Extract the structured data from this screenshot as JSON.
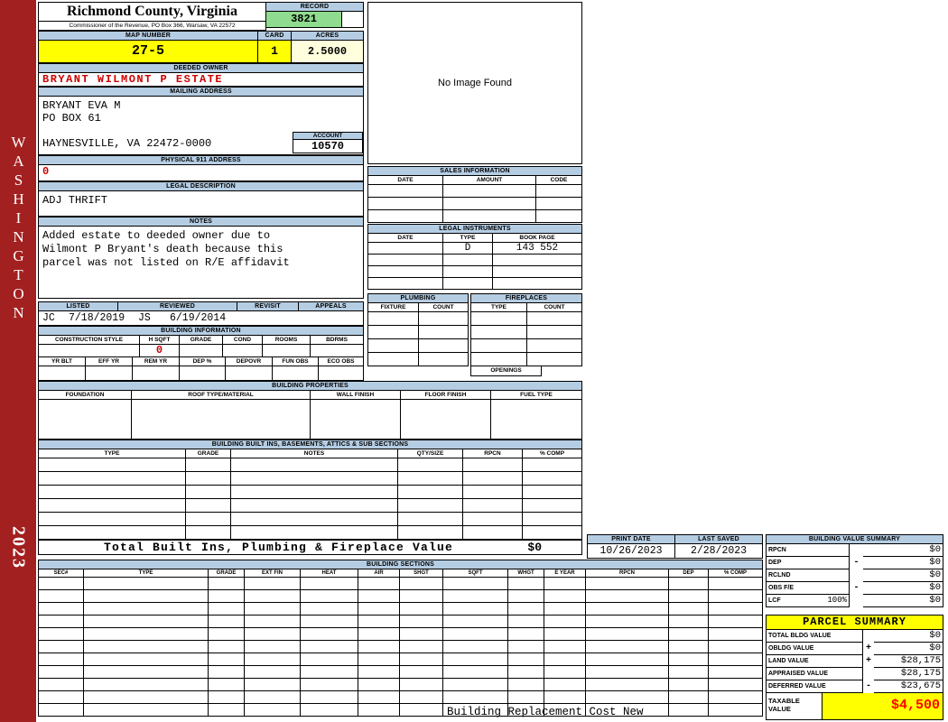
{
  "colors": {
    "header_bar": "#B5CDE3",
    "record_value_bg": "#8FDB8F",
    "highlight_yellow": "#FFFF00",
    "acres_bg": "#FFFFDE",
    "sidebar_red": "#A32020",
    "alert_red": "#CC0000",
    "taxable_red": "#FF0000"
  },
  "sidebar": {
    "state_text": "WASHINGTON",
    "year": "2023"
  },
  "header": {
    "county_title": "Richmond County, Virginia",
    "commissioner_line": "Commissioner of the Revenue, PO Box 366, Warsaw, VA 22572",
    "record": {
      "label": "RECORD",
      "value": "3821"
    },
    "map_number": {
      "label": "MAP NUMBER",
      "value": "27-5"
    },
    "card": {
      "label": "CARD",
      "value": "1"
    },
    "acres": {
      "label": "ACRES",
      "value": "2.5000"
    }
  },
  "owner": {
    "deeded_owner": {
      "label": "DEEDED OWNER",
      "value": "BRYANT WILMONT P ESTATE"
    },
    "mailing_address": {
      "label": "MAILING ADDRESS",
      "lines": [
        "BRYANT EVA M",
        "PO BOX 61",
        "",
        "HAYNESVILLE, VA 22472-0000"
      ]
    },
    "account": {
      "label": "ACCOUNT",
      "value": "10570"
    },
    "physical_911_address": {
      "label": "PHYSICAL 911 ADDRESS",
      "value": "0"
    },
    "legal_description": {
      "label": "LEGAL DESCRIPTION",
      "value": "ADJ THRIFT"
    },
    "notes": {
      "label": "NOTES",
      "lines": [
        "Added estate to deeded owner due to",
        "Wilmont P Bryant's death because this",
        "parcel was not listed on R/E affidavit"
      ]
    }
  },
  "review": {
    "headers": [
      "LISTED",
      "REVIEWED",
      "REVISIT",
      "APPEALS"
    ],
    "listed_by": "JC",
    "listed_date": "7/18/2019",
    "reviewed_by": "JS",
    "reviewed_date": "6/19/2014"
  },
  "building_information": {
    "label": "BUILDING INFORMATION",
    "row1_headers": [
      "CONSTRUCTION STYLE",
      "H SQFT",
      "GRADE",
      "COND",
      "ROOMS",
      "BDRMS"
    ],
    "h_sqft_value": "0",
    "row2_headers": [
      "YR BLT",
      "EFF YR",
      "REM YR",
      "DEP %",
      "DEPOVR",
      "FUN OBS",
      "ECO OBS"
    ]
  },
  "photo": {
    "placeholder": "No Image Found"
  },
  "sales_information": {
    "label": "SALES INFORMATION",
    "headers": [
      "DATE",
      "AMOUNT",
      "CODE"
    ]
  },
  "legal_instruments": {
    "label": "LEGAL INSTRUMENTS",
    "headers": [
      "DATE",
      "TYPE",
      "BOOK PAGE"
    ],
    "rows": [
      [
        "",
        "D",
        "143 552"
      ]
    ]
  },
  "plumbing": {
    "label": "PLUMBING",
    "headers": [
      "FIXTURE",
      "COUNT"
    ]
  },
  "fireplaces": {
    "label": "FIREPLACES",
    "headers": [
      "TYPE",
      "COUNT"
    ],
    "openings_label": "OPENINGS"
  },
  "building_properties": {
    "label": "BUILDING PROPERTIES",
    "headers": [
      "FOUNDATION",
      "ROOF TYPE/MATERIAL",
      "WALL FINISH",
      "FLOOR FINISH",
      "FUEL TYPE"
    ]
  },
  "built_ins": {
    "label": "BUILDING BUILT INS, BASEMENTS, ATTICS & SUB SECTIONS",
    "headers": [
      "TYPE",
      "GRADE",
      "NOTES",
      "QTY/SIZE",
      "RPCN",
      "% COMP"
    ],
    "total_label": "Total Built Ins, Plumbing & Fireplace Value",
    "total_value": "$0"
  },
  "dates": {
    "print_date": {
      "label": "PRINT DATE",
      "value": "10/26/2023"
    },
    "last_saved": {
      "label": "LAST SAVED",
      "value": "2/28/2023"
    }
  },
  "building_value_summary": {
    "label": "BUILDING VALUE SUMMARY",
    "rows": [
      {
        "name": "RPCN",
        "extra": "",
        "op": "",
        "value": "$0"
      },
      {
        "name": "DEP",
        "extra": "",
        "op": "-",
        "value": "$0"
      },
      {
        "name": "RCLND",
        "extra": "",
        "op": "",
        "value": "$0"
      },
      {
        "name": "OBS F/E",
        "extra": "",
        "op": "-",
        "value": "$0"
      },
      {
        "name": "LCF",
        "extra": "100%",
        "op": "",
        "value": "$0"
      }
    ]
  },
  "building_sections": {
    "label": "BUILDING SECTIONS",
    "headers": [
      "SEC#",
      "TYPE",
      "GRADE",
      "EXT FIN",
      "HEAT",
      "AIR",
      "SHGT",
      "SQFT",
      "WHGT",
      "E YEAR",
      "RPCN",
      "DEP",
      "% COMP"
    ]
  },
  "parcel_summary": {
    "label": "PARCEL SUMMARY",
    "rows": [
      {
        "name": "TOTAL BLDG VALUE",
        "op": "",
        "value": "$0"
      },
      {
        "name": "OBLDG VALUE",
        "op": "+",
        "value": "$0"
      },
      {
        "name": "LAND VALUE",
        "op": "+",
        "value": "$28,175"
      },
      {
        "name": "APPRAISED VALUE",
        "op": "",
        "value": "$28,175"
      },
      {
        "name": "DEFERRED VALUE",
        "op": "-",
        "value": "$23,675"
      }
    ],
    "taxable": {
      "label_line1": "TAXABLE",
      "label_line2": "VALUE",
      "value": "$4,500"
    }
  },
  "footer": {
    "text": "Building Replacement Cost New"
  }
}
